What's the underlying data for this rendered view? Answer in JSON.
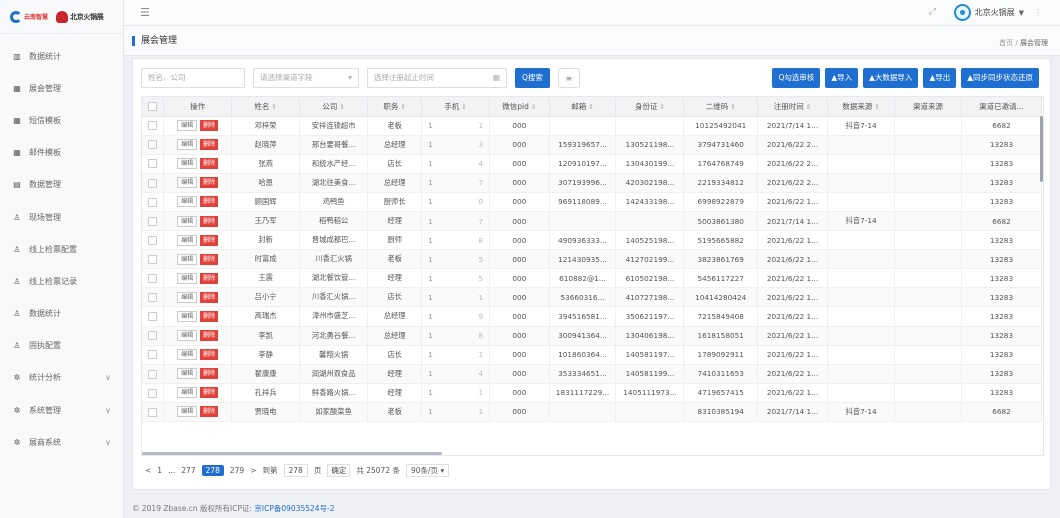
{
  "brand": {
    "logo_left_text": "云南智慧",
    "logo_right_text": "北京火锅展"
  },
  "topbar": {
    "user_name": "北京火锅展"
  },
  "sidebar": {
    "items": [
      {
        "label": "数据统计",
        "icon": "chart-icon",
        "icon_glyph": "▥"
      },
      {
        "label": "展会管理",
        "icon": "table-icon",
        "icon_glyph": "▦"
      },
      {
        "label": "短信模板",
        "icon": "table-icon",
        "icon_glyph": "▦"
      },
      {
        "label": "邮件模板",
        "icon": "table-icon",
        "icon_glyph": "▦"
      },
      {
        "label": "数据管理",
        "icon": "list-icon",
        "icon_glyph": "▤"
      },
      {
        "label": "现场管理",
        "icon": "user-icon",
        "icon_glyph": "♙"
      },
      {
        "label": "线上检票配置",
        "icon": "user-icon",
        "icon_glyph": "♙"
      },
      {
        "label": "线上检票记录",
        "icon": "user-icon",
        "icon_glyph": "♙"
      },
      {
        "label": "数据统计",
        "icon": "user-icon",
        "icon_glyph": "♙"
      },
      {
        "label": "固执配置",
        "icon": "user-icon",
        "icon_glyph": "♙"
      },
      {
        "label": "统计分析",
        "icon": "gear-icon",
        "icon_glyph": "✲",
        "has_arrow": true
      },
      {
        "label": "系统管理",
        "icon": "gear-icon",
        "icon_glyph": "✲",
        "has_arrow": true
      },
      {
        "label": "展商系统",
        "icon": "gear-icon",
        "icon_glyph": "✲",
        "has_arrow": true
      }
    ]
  },
  "page": {
    "title": "展会管理",
    "breadcrumb_home": "首页",
    "breadcrumb_sep": "/",
    "breadcrumb_current": "展会管理"
  },
  "filters": {
    "keyword_placeholder": "姓名、公司",
    "source_placeholder": "请选择渠道字段",
    "date_placeholder": "选择注册起止时间",
    "search_label": "Q搜索",
    "toggle_label": "≡"
  },
  "actions": {
    "check_audit": "Q勾选审核",
    "import": "▲导入",
    "bulk_import": "▲大数据导入",
    "export": "▲导出",
    "sync": "▲同步同步状态还原"
  },
  "table": {
    "columns": [
      "",
      "操作",
      "姓名",
      "公司",
      "职务",
      "手机",
      "微信pid",
      "邮箱",
      "身份证",
      "二维码",
      "注册时间",
      "数据来源",
      "渠道来源",
      "渠道已邀请..."
    ],
    "edit_label": "编辑",
    "delete_label": "删除",
    "rows": [
      {
        "name": "邓梓荣",
        "company": "安祥连锁超市",
        "title": "老板",
        "phone_l": "1",
        "phone_r": "1",
        "wx": "000",
        "email": "",
        "idcard": "",
        "qr": "10125492041",
        "time": "2021/7/14 1...",
        "source": "抖音7-14",
        "channel": "",
        "invited": "6682"
      },
      {
        "name": "赵晓萍",
        "company": "邢台要哥餐...",
        "title": "总经理",
        "phone_l": "1",
        "phone_r": "3",
        "wx": "000",
        "email": "159319657...",
        "idcard": "130521198...",
        "qr": "3794731460",
        "time": "2021/6/22 2...",
        "source": "",
        "channel": "",
        "invited": "13283"
      },
      {
        "name": "张燕",
        "company": "和统水产经...",
        "title": "店长",
        "phone_l": "1",
        "phone_r": "4",
        "wx": "000",
        "email": "120910197...",
        "idcard": "130430199...",
        "qr": "1764768749",
        "time": "2021/6/22 2...",
        "source": "",
        "channel": "",
        "invited": "13283"
      },
      {
        "name": "哈恩",
        "company": "湖北往美食...",
        "title": "总经理",
        "phone_l": "1",
        "phone_r": "7",
        "wx": "000",
        "email": "307193996...",
        "idcard": "420302198...",
        "qr": "2219334812",
        "time": "2021/6/22 2...",
        "source": "",
        "channel": "",
        "invited": "13283"
      },
      {
        "name": "顾国辉",
        "company": "鸡鸭鱼",
        "title": "厨师长",
        "phone_l": "1",
        "phone_r": "0",
        "wx": "000",
        "email": "969118089...",
        "idcard": "142433198...",
        "qr": "6998922879",
        "time": "2021/6/22 1...",
        "source": "",
        "channel": "",
        "invited": "13283"
      },
      {
        "name": "王乃军",
        "company": "稻鸭稻公",
        "title": "经理",
        "phone_l": "1",
        "phone_r": "7",
        "wx": "000",
        "email": "",
        "idcard": "",
        "qr": "5003861380",
        "time": "2021/7/14 1...",
        "source": "抖音7-14",
        "channel": "",
        "invited": "6682"
      },
      {
        "name": "封新",
        "company": "晋城成都巴...",
        "title": "厨师",
        "phone_l": "1",
        "phone_r": "8",
        "wx": "000",
        "email": "490936333...",
        "idcard": "140525198...",
        "qr": "5195665882",
        "time": "2021/6/22 1...",
        "source": "",
        "channel": "",
        "invited": "13283"
      },
      {
        "name": "时富成",
        "company": "川香汇火锅",
        "title": "老板",
        "phone_l": "1",
        "phone_r": "5",
        "wx": "000",
        "email": "121430935...",
        "idcard": "412702199...",
        "qr": "3823861769",
        "time": "2021/6/22 1...",
        "source": "",
        "channel": "",
        "invited": "13283"
      },
      {
        "name": "王震",
        "company": "湖北餐饮管...",
        "title": "经理",
        "phone_l": "1",
        "phone_r": "5",
        "wx": "000",
        "email": "610882@1...",
        "idcard": "610502198...",
        "qr": "5456117227",
        "time": "2021/6/22 1...",
        "source": "",
        "channel": "",
        "invited": "13283"
      },
      {
        "name": "吕小宁",
        "company": "川香汇火锅...",
        "title": "店长",
        "phone_l": "1",
        "phone_r": "1",
        "wx": "000",
        "email": "53660316...",
        "idcard": "410727198...",
        "qr": "10414280424",
        "time": "2021/6/22 1...",
        "source": "",
        "channel": "",
        "invited": "13283"
      },
      {
        "name": "高瑞杰",
        "company": "漳州市盛芝...",
        "title": "总经理",
        "phone_l": "1",
        "phone_r": "9",
        "wx": "000",
        "email": "394516581...",
        "idcard": "350621197...",
        "qr": "7215849408",
        "time": "2021/6/22 1...",
        "source": "",
        "channel": "",
        "invited": "13283"
      },
      {
        "name": "李凯",
        "company": "河北勇谷餐...",
        "title": "总经理",
        "phone_l": "1",
        "phone_r": "8",
        "wx": "000",
        "email": "300941364...",
        "idcard": "130406198...",
        "qr": "1618158051",
        "time": "2021/6/22 1...",
        "source": "",
        "channel": "",
        "invited": "13283"
      },
      {
        "name": "李静",
        "company": "馨翔火锅",
        "title": "店长",
        "phone_l": "1",
        "phone_r": "1",
        "wx": "000",
        "email": "101860364...",
        "idcard": "140581197...",
        "qr": "1789092911",
        "time": "2021/6/22 1...",
        "source": "",
        "channel": "",
        "invited": "13283"
      },
      {
        "name": "翟康康",
        "company": "润湖州双食品",
        "title": "经理",
        "phone_l": "1",
        "phone_r": "4",
        "wx": "000",
        "email": "353334651...",
        "idcard": "140581199...",
        "qr": "7410311653",
        "time": "2021/6/22 1...",
        "source": "",
        "channel": "",
        "invited": "13283"
      },
      {
        "name": "孔祥兵",
        "company": "鲜香路火锅...",
        "title": "经理",
        "phone_l": "1",
        "phone_r": "1",
        "wx": "000",
        "email": "1831117229...",
        "idcard": "1405111973...",
        "qr": "4719657415",
        "time": "2021/6/22 1...",
        "source": "",
        "channel": "",
        "invited": "13283"
      },
      {
        "name": "贾晓电",
        "company": "如家酸菜鱼",
        "title": "老板",
        "phone_l": "1",
        "phone_r": "1",
        "wx": "000",
        "email": "",
        "idcard": "",
        "qr": "8310385194",
        "time": "2021/7/14 1...",
        "source": "抖音7-14",
        "channel": "",
        "invited": "6682"
      }
    ]
  },
  "pager": {
    "prev": "<",
    "first": "1",
    "ellipsis": "...",
    "p1": "277",
    "current": "278",
    "p3": "279",
    "next": ">",
    "goto_label": "到第",
    "goto_value": "278",
    "page_unit": "页",
    "confirm": "确定",
    "total": "共 25072 条",
    "page_size": "90条/页 ▾"
  },
  "footer": {
    "copyright": "© 2019 Zbase.cn 版权所有ICP证:",
    "icp": "京ICP备09035524号-2"
  }
}
